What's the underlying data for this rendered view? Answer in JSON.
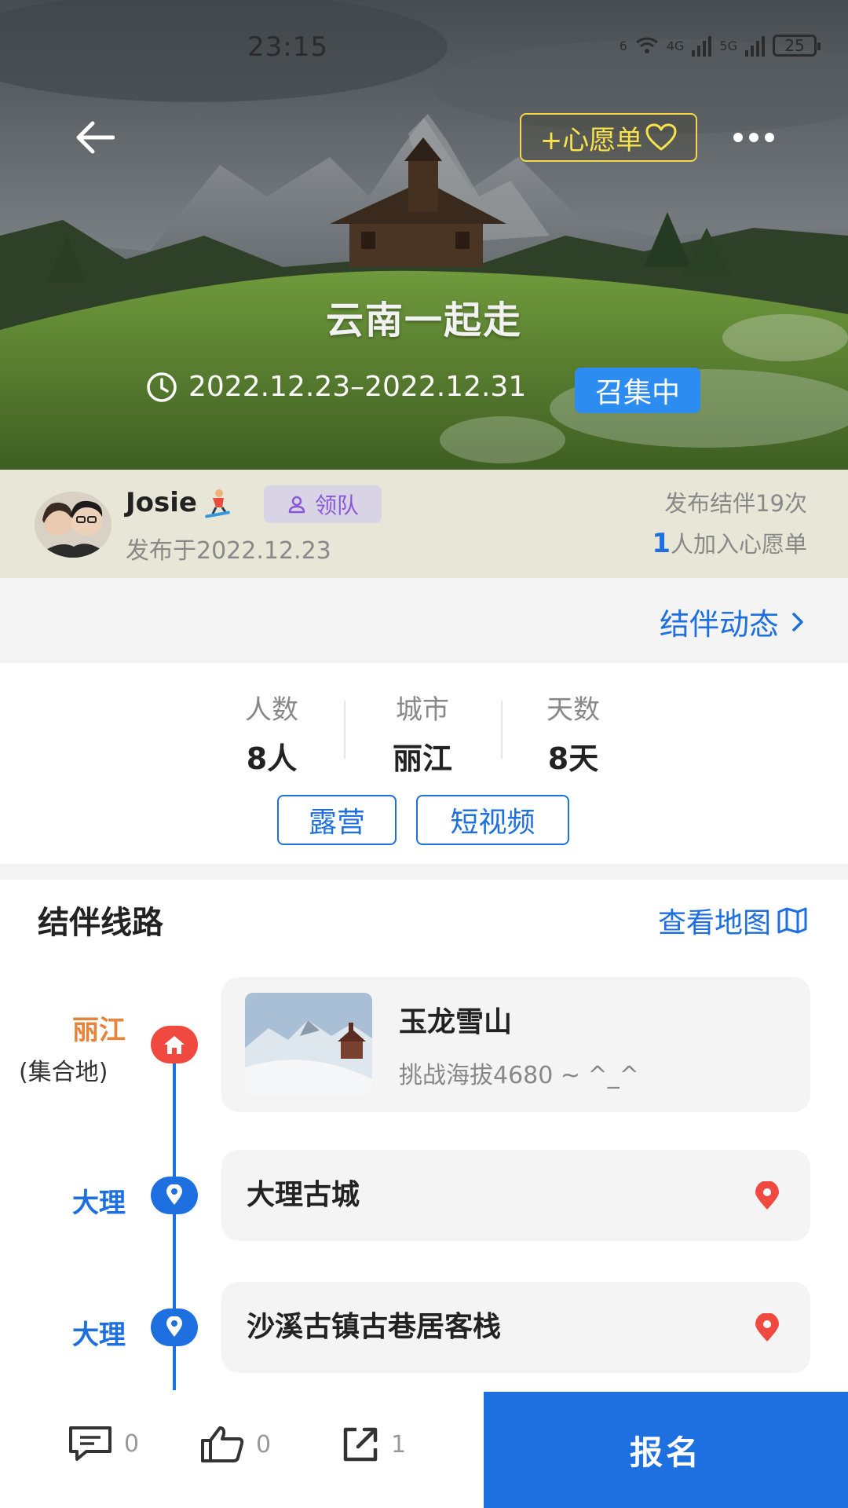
{
  "status_bar": {
    "time": "23:15",
    "network_1": "6",
    "network_2": "4G",
    "network_3": "5G",
    "battery": "25"
  },
  "header": {
    "wishlist_label": "+心愿单"
  },
  "hero": {
    "title": "云南一起走",
    "date_range": "2022.12.23–2022.12.31",
    "status_badge": "召集中"
  },
  "author": {
    "name": "Josie",
    "role": "领队",
    "published": "发布于2022.12.23",
    "post_count": "发布结伴19次",
    "wish_number": "1",
    "wish_text": "人加入心愿单"
  },
  "dynamics": {
    "label": "结伴动态"
  },
  "stats": [
    {
      "label": "人数",
      "value": "8人"
    },
    {
      "label": "城市",
      "value": "丽江"
    },
    {
      "label": "天数",
      "value": "8天"
    }
  ],
  "tags": [
    "露营",
    "短视频"
  ],
  "route": {
    "title": "结伴线路",
    "map_link": "查看地图",
    "stops": [
      {
        "city": "丽江",
        "note": "(集合地)",
        "title": "玉龙雪山",
        "subtitle": "挑战海拔4680 ~ ^_^"
      },
      {
        "city": "大理",
        "title": "大理古城"
      },
      {
        "city": "大理",
        "title": "沙溪古镇古巷居客栈"
      }
    ]
  },
  "bottom_bar": {
    "comments": "0",
    "likes": "0",
    "shares": "1",
    "signup": "报名"
  },
  "colors": {
    "accent": "#1e6fe0",
    "recruit_badge": "#2d8cf0",
    "wish_yellow": "#f8e34c",
    "orange": "#e8833a",
    "red": "#f0493f",
    "author_bg": "#e8e7d7"
  },
  "icons": [
    "back-arrow-icon",
    "heart-icon",
    "more-icon",
    "clock-icon",
    "person-icon",
    "chevron-right-icon",
    "map-icon",
    "home-icon",
    "location-icon",
    "pin-icon",
    "comment-icon",
    "thumbs-up-icon",
    "share-icon"
  ]
}
